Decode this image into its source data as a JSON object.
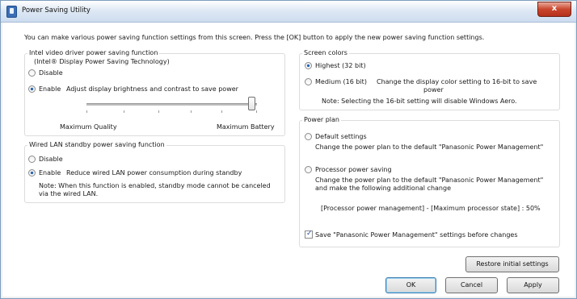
{
  "window": {
    "title": "Power Saving Utility",
    "close_glyph": "x"
  },
  "intro": "You can make various power saving function settings from this screen. Press the [OK] button to apply the new power saving function settings.",
  "video": {
    "title": "Intel video driver power saving function",
    "subtitle": "(Intel® Display Power Saving Technology)",
    "disable_label": "Disable",
    "enable_label": "Enable",
    "enable_desc": "Adjust display brightness and contrast to save power",
    "selected": "enable",
    "slider_min_label": "Maximum Quality",
    "slider_max_label": "Maximum Battery",
    "slider_level": 1.0
  },
  "lan": {
    "title": "Wired LAN standby power saving function",
    "disable_label": "Disable",
    "enable_label": "Enable",
    "enable_desc": "Reduce wired LAN power consumption during standby",
    "note_line1": "Note: When this function is enabled, standby mode cannot be canceled",
    "note_line2": "via the wired LAN.",
    "selected": "enable"
  },
  "colors": {
    "title": "Screen colors",
    "highest_label": "Highest (32 bit)",
    "medium_label": "Medium (16 bit)",
    "medium_desc_line1": "Change the display color setting to 16-bit to save",
    "medium_desc_line2": "power",
    "note": "Note: Selecting the 16-bit setting will disable Windows Aero.",
    "selected": "highest"
  },
  "plan": {
    "title": "Power plan",
    "default_label": "Default settings",
    "default_desc": "Change the power plan to the default \"Panasonic Power Management\"",
    "processor_label": "Processor power saving",
    "processor_desc_line1": "Change the power plan to the default \"Panasonic Power Management\"",
    "processor_desc_line2": "and make the following additional change",
    "processor_state": "[Processor power management] - [Maximum processor state] : 50%",
    "save_label": "Save \"Panasonic Power Management\" settings before changes",
    "save_checked": true
  },
  "buttons": {
    "restore": "Restore initial settings",
    "ok": "OK",
    "cancel": "Cancel",
    "apply": "Apply"
  }
}
